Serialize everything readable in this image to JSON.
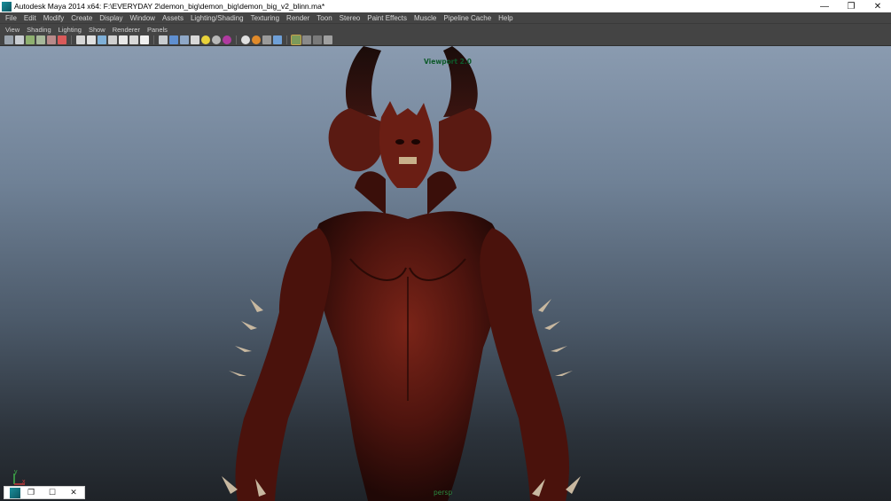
{
  "window": {
    "title": "Autodesk Maya 2014 x64: F:\\EVERYDAY 2\\demon_big\\demon_big\\demon_big_v2_blinn.ma*",
    "minimize": "—",
    "restore": "❐",
    "close": "✕"
  },
  "menubar": {
    "items": [
      "File",
      "Edit",
      "Modify",
      "Create",
      "Display",
      "Window",
      "Assets",
      "Lighting/Shading",
      "Texturing",
      "Render",
      "Toon",
      "Stereo",
      "Paint Effects",
      "Muscle",
      "Pipeline Cache",
      "Help"
    ]
  },
  "panel_menu": {
    "items": [
      "View",
      "Shading",
      "Lighting",
      "Show",
      "Renderer",
      "Panels"
    ]
  },
  "toolbar": {
    "icons": [
      "camera-attributes-icon",
      "select-camera-icon",
      "bookmark-icon",
      "image-plane-icon",
      "two-d-pan-zoom-icon",
      "grease-pencil-icon",
      "grid-icon",
      "film-gate-icon",
      "resolution-gate-icon",
      "gate-mask-icon",
      "field-chart-icon",
      "safe-action-icon",
      "safe-title-icon",
      "wireframe-icon",
      "smooth-shade-icon",
      "wireframe-on-shaded-icon",
      "textured-icon",
      "use-all-lights-icon",
      "shadows-icon",
      "high-quality-icon",
      "xray-icon",
      "xray-joints-icon",
      "isolate-select-icon",
      "backface-culling-icon",
      "ambient-occlusion-icon",
      "motion-blur-icon",
      "multisample-aa-icon",
      "depth-of-field-icon"
    ]
  },
  "viewport": {
    "label": "Viewport 2.0",
    "camera": "persp",
    "axis_y": "y",
    "axis_x": "x"
  },
  "mini_window": {
    "restore": "❐",
    "maximize": "☐",
    "close": "✕"
  }
}
